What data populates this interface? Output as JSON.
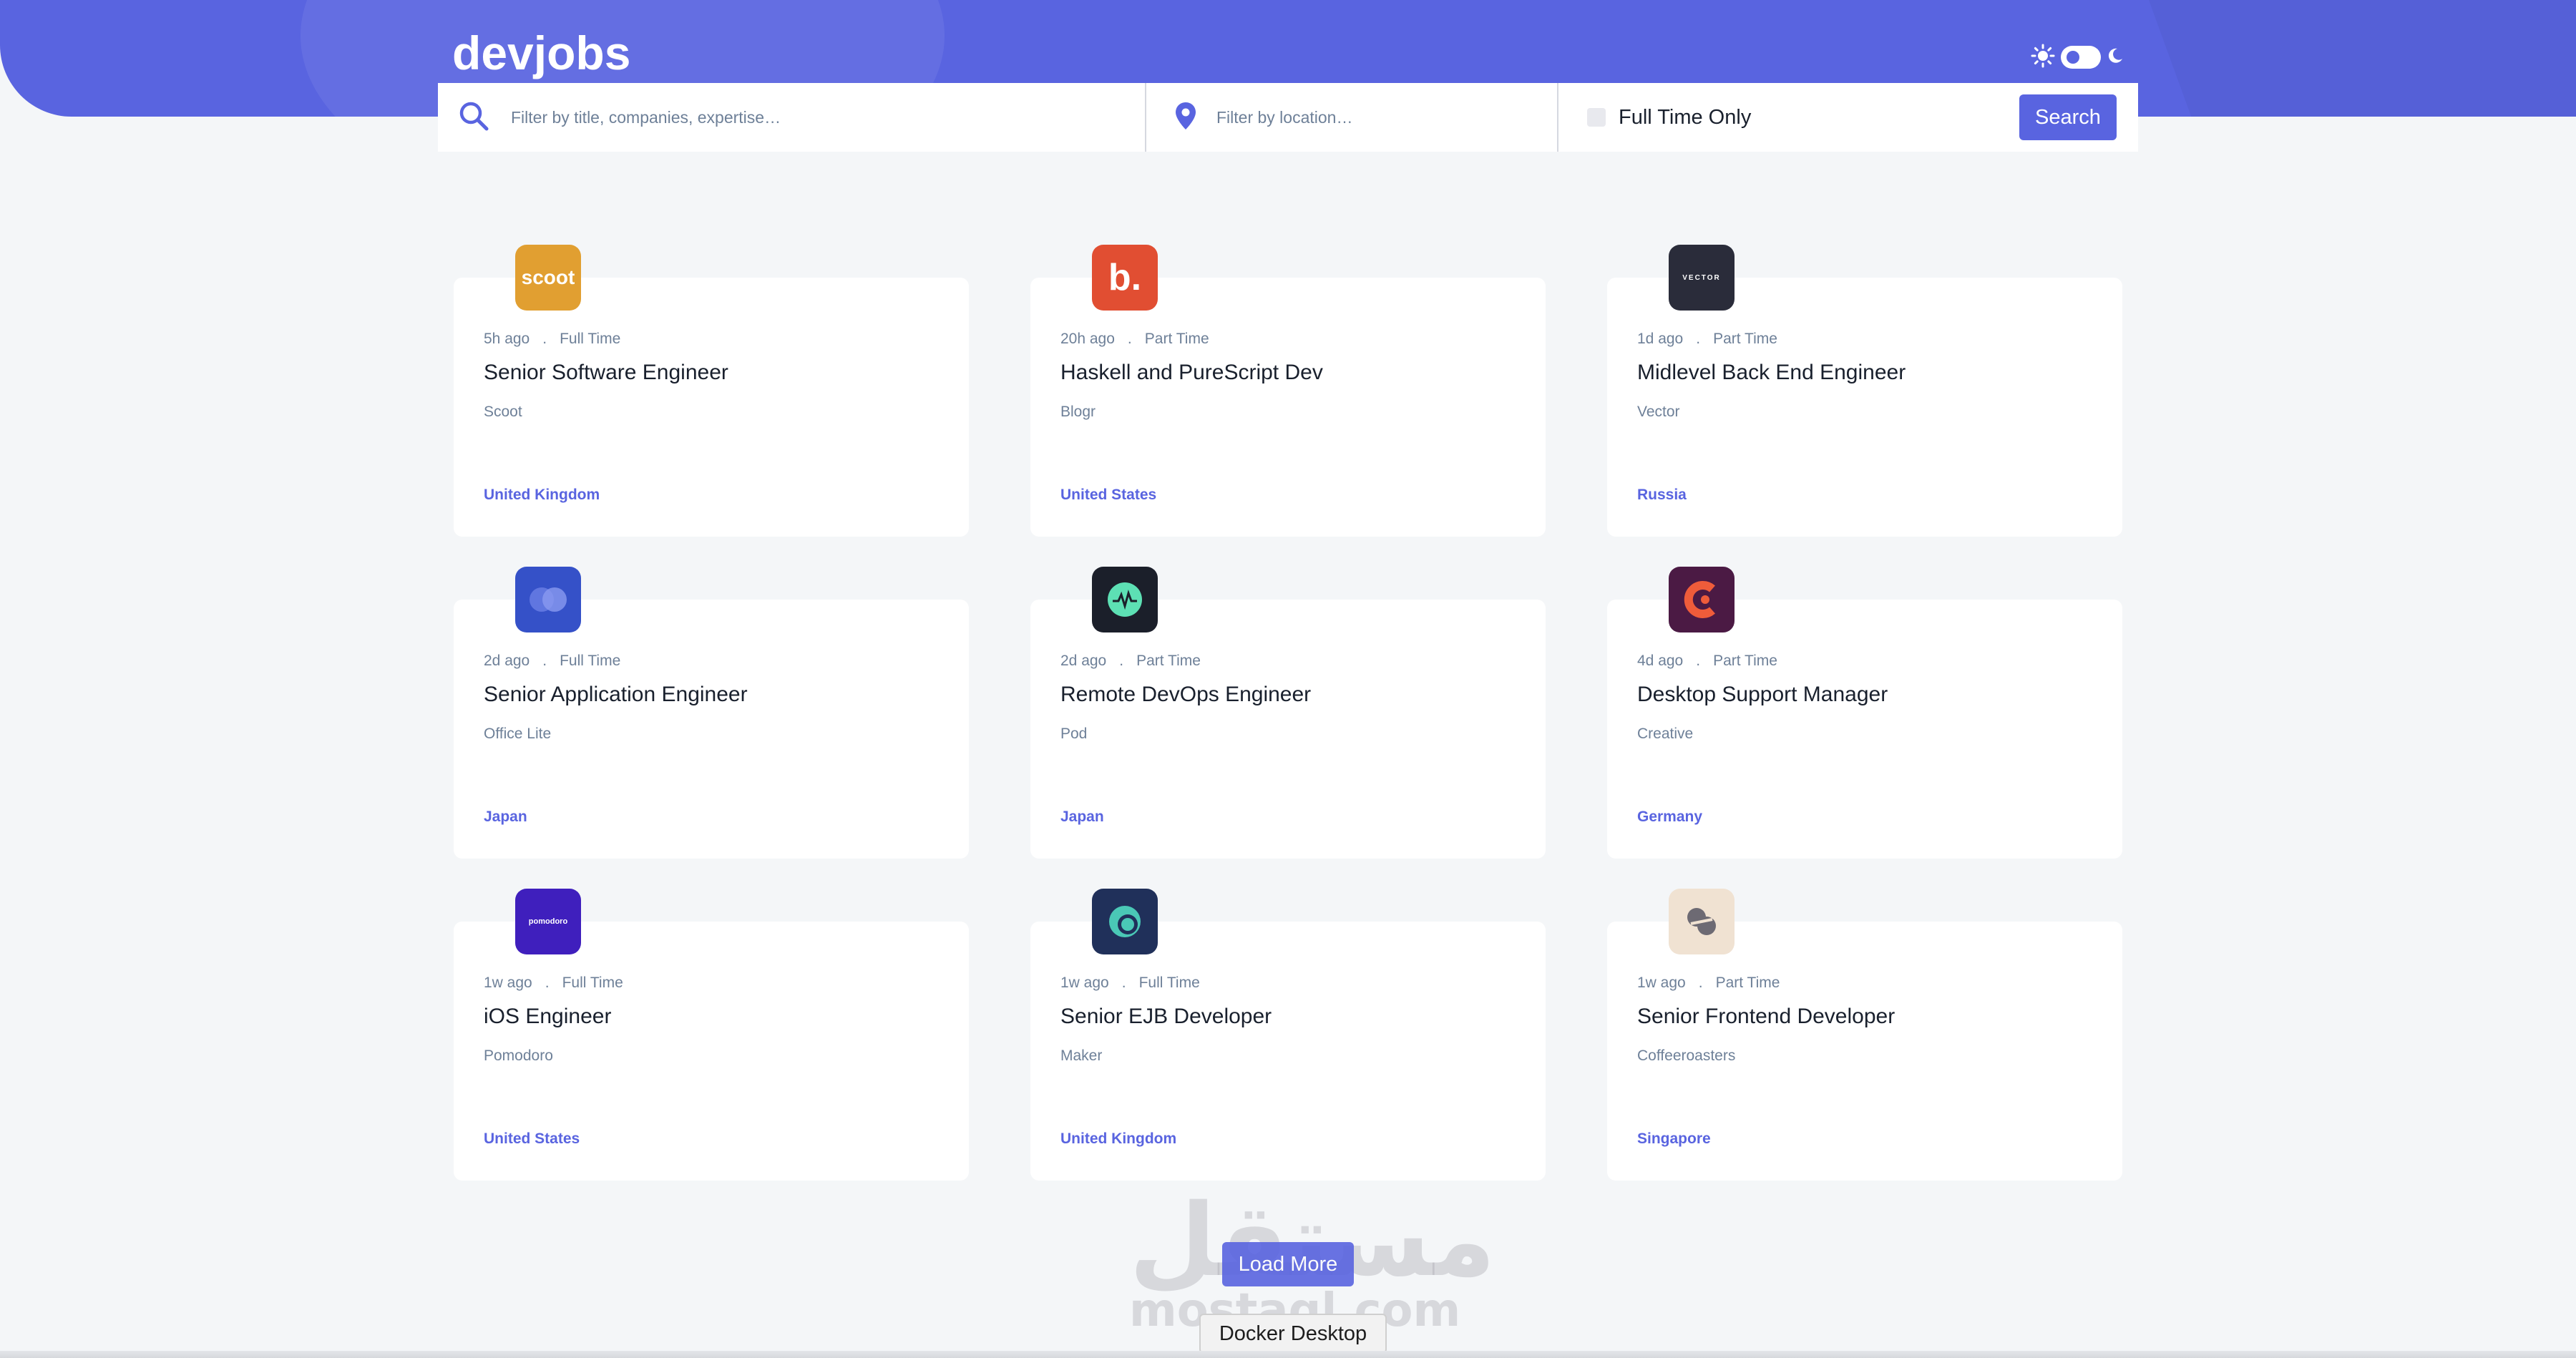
{
  "app": {
    "logo": "devjobs",
    "colors": {
      "brand": "#5964e0",
      "background": "#f4f6f8",
      "card": "#ffffff",
      "text": "#19202d",
      "muted": "#6e8098"
    }
  },
  "theme_toggle": {
    "sun_icon": "sun-icon",
    "moon_icon": "moon-icon",
    "mode": "light"
  },
  "search": {
    "title_placeholder": "Filter by title, companies, expertise…",
    "location_placeholder": "Filter by location…",
    "full_time_label": "Full Time Only",
    "full_time_checked": false,
    "button_label": "Search"
  },
  "jobs": [
    {
      "logo_text": "scoot",
      "logo_color": "#e19f31",
      "posted": "5h ago",
      "contract": "Full Time",
      "position": "Senior Software Engineer",
      "company": "Scoot",
      "location": "United Kingdom"
    },
    {
      "logo_text": "b.",
      "logo_color": "#e14e32",
      "posted": "20h ago",
      "contract": "Part Time",
      "position": "Haskell and PureScript Dev",
      "company": "Blogr",
      "location": "United States"
    },
    {
      "logo_text": "VECTOR",
      "logo_color": "#2a2c3a",
      "posted": "1d ago",
      "contract": "Part Time",
      "position": "Midlevel Back End Engineer",
      "company": "Vector",
      "location": "Russia"
    },
    {
      "logo_text": "",
      "logo_color": "#3551c8",
      "posted": "2d ago",
      "contract": "Full Time",
      "position": "Senior Application Engineer",
      "company": "Office Lite",
      "location": "Japan"
    },
    {
      "logo_text": "",
      "logo_color": "#1b1f2a",
      "posted": "2d ago",
      "contract": "Part Time",
      "position": "Remote DevOps Engineer",
      "company": "Pod",
      "location": "Japan"
    },
    {
      "logo_text": "",
      "logo_color": "#4b1a44",
      "posted": "4d ago",
      "contract": "Part Time",
      "position": "Desktop Support Manager",
      "company": "Creative",
      "location": "Germany"
    },
    {
      "logo_text": "pomodoro",
      "logo_color": "#3f1fbd",
      "posted": "1w ago",
      "contract": "Full Time",
      "position": "iOS Engineer",
      "company": "Pomodoro",
      "location": "United States"
    },
    {
      "logo_text": "",
      "logo_color": "#20305a",
      "posted": "1w ago",
      "contract": "Full Time",
      "position": "Senior EJB Developer",
      "company": "Maker",
      "location": "United Kingdom"
    },
    {
      "logo_text": "",
      "logo_color": "#f0e2d2",
      "posted": "1w ago",
      "contract": "Part Time",
      "position": "Senior Frontend Developer",
      "company": "Coffeeroasters",
      "location": "Singapore"
    }
  ],
  "dot": ".",
  "load_more_label": "Load More",
  "tooltip": "Docker Desktop",
  "watermark": {
    "arabic": "مستقل",
    "latin": "mostaql.com"
  }
}
